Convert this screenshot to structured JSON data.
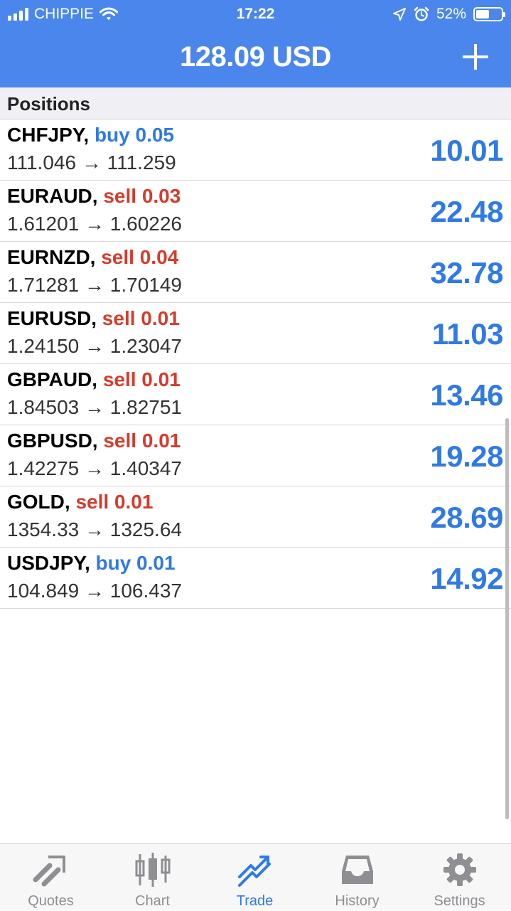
{
  "status": {
    "carrier": "CHIPPIE",
    "time": "17:22",
    "battery_text": "52%",
    "battery_level": 0.52
  },
  "nav": {
    "title": "128.09 USD"
  },
  "section": {
    "title": "Positions"
  },
  "positions": [
    {
      "symbol": "CHFJPY,",
      "side": "buy 0.05",
      "type": "buy",
      "prices": "111.046 → 111.259",
      "profit": "10.01"
    },
    {
      "symbol": "EURAUD,",
      "side": "sell 0.03",
      "type": "sell",
      "prices": "1.61201 → 1.60226",
      "profit": "22.48"
    },
    {
      "symbol": "EURNZD,",
      "side": "sell 0.04",
      "type": "sell",
      "prices": "1.71281 → 1.70149",
      "profit": "32.78"
    },
    {
      "symbol": "EURUSD,",
      "side": "sell 0.01",
      "type": "sell",
      "prices": "1.24150 → 1.23047",
      "profit": "11.03"
    },
    {
      "symbol": "GBPAUD,",
      "side": "sell 0.01",
      "type": "sell",
      "prices": "1.84503 → 1.82751",
      "profit": "13.46"
    },
    {
      "symbol": "GBPUSD,",
      "side": "sell 0.01",
      "type": "sell",
      "prices": "1.42275 → 1.40347",
      "profit": "19.28"
    },
    {
      "symbol": "GOLD,",
      "side": "sell 0.01",
      "type": "sell",
      "prices": "1354.33 → 1325.64",
      "profit": "28.69"
    },
    {
      "symbol": "USDJPY,",
      "side": "buy 0.01",
      "type": "buy",
      "prices": "104.849 → 106.437",
      "profit": "14.92"
    }
  ],
  "tabs": [
    {
      "label": "Quotes",
      "icon": "quotes-icon",
      "active": false
    },
    {
      "label": "Chart",
      "icon": "chart-icon",
      "active": false
    },
    {
      "label": "Trade",
      "icon": "trade-icon",
      "active": true
    },
    {
      "label": "History",
      "icon": "history-icon",
      "active": false
    },
    {
      "label": "Settings",
      "icon": "settings-icon",
      "active": false
    }
  ],
  "colors": {
    "header": "#4a86ec",
    "buy": "#2f7ae5",
    "sell": "#d63b2c",
    "profit": "#2f7ae5",
    "tab_inactive": "#8e8e93",
    "tab_active": "#2f7ae5"
  }
}
